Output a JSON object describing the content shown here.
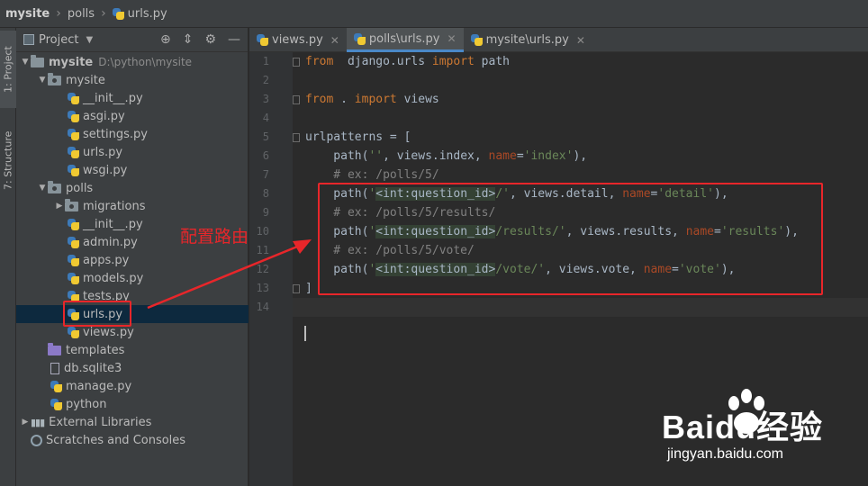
{
  "breadcrumb": {
    "root": "mysite",
    "folder": "polls",
    "file": "urls.py"
  },
  "toolstrip": {
    "project_tab": "1: Project",
    "structure_tab": "7: Structure"
  },
  "project_panel": {
    "title": "Project",
    "tree": [
      {
        "label": "mysite",
        "sub": "D:\\python\\mysite",
        "kind": "folder",
        "arrow": "▼",
        "depth": 0,
        "bold": true
      },
      {
        "label": "mysite",
        "kind": "pkg",
        "arrow": "▼",
        "depth": 1
      },
      {
        "label": "__init__.py",
        "kind": "py",
        "depth": 2
      },
      {
        "label": "asgi.py",
        "kind": "py",
        "depth": 2
      },
      {
        "label": "settings.py",
        "kind": "py",
        "depth": 2
      },
      {
        "label": "urls.py",
        "kind": "py",
        "depth": 2
      },
      {
        "label": "wsgi.py",
        "kind": "py",
        "depth": 2
      },
      {
        "label": "polls",
        "kind": "pkg",
        "arrow": "▼",
        "depth": 1
      },
      {
        "label": "migrations",
        "kind": "pkg",
        "arrow": "▶",
        "depth": 2
      },
      {
        "label": "__init__.py",
        "kind": "py",
        "depth": 2
      },
      {
        "label": "admin.py",
        "kind": "py",
        "depth": 2
      },
      {
        "label": "apps.py",
        "kind": "py",
        "depth": 2
      },
      {
        "label": "models.py",
        "kind": "py",
        "depth": 2
      },
      {
        "label": "tests.py",
        "kind": "py",
        "depth": 2
      },
      {
        "label": "urls.py",
        "kind": "py",
        "depth": 2,
        "selected": true
      },
      {
        "label": "views.py",
        "kind": "py",
        "depth": 2
      },
      {
        "label": "templates",
        "kind": "tpl",
        "depth": 1
      },
      {
        "label": "db.sqlite3",
        "kind": "db",
        "depth": 1
      },
      {
        "label": "manage.py",
        "kind": "py",
        "depth": 1
      },
      {
        "label": "python",
        "kind": "py",
        "depth": 1
      },
      {
        "label": "External Libraries",
        "kind": "lib",
        "arrow": "▶",
        "depth": 0
      },
      {
        "label": "Scratches and Consoles",
        "kind": "scratch",
        "depth": 0
      }
    ]
  },
  "editor": {
    "tabs": [
      {
        "label": "views.py",
        "active": false
      },
      {
        "label": "polls\\urls.py",
        "active": true
      },
      {
        "label": "mysite\\urls.py",
        "active": false
      }
    ],
    "line_numbers": [
      "1",
      "2",
      "3",
      "4",
      "5",
      "6",
      "7",
      "8",
      "9",
      "10",
      "11",
      "12",
      "13",
      "14"
    ],
    "lines": [
      [
        [
          "kw",
          "from"
        ],
        [
          "",
          "  django.urls "
        ],
        [
          "kw",
          "import"
        ],
        [
          "",
          " path"
        ]
      ],
      [],
      [
        [
          "kw",
          "from"
        ],
        [
          "",
          " . "
        ],
        [
          "kw",
          "import"
        ],
        [
          "",
          " views"
        ]
      ],
      [],
      [
        [
          "",
          "urlpatterns = ["
        ]
      ],
      [
        [
          "",
          "    path("
        ],
        [
          "str",
          "''"
        ],
        [
          "",
          ", views.index, "
        ],
        [
          "nm",
          "name"
        ],
        [
          "",
          "="
        ],
        [
          "str",
          "'index'"
        ],
        [
          "",
          "),"
        ]
      ],
      [
        [
          "cm",
          "    # ex: /polls/5/"
        ]
      ],
      [
        [
          "",
          "    path("
        ],
        [
          "str",
          "'"
        ],
        [
          "rt",
          "<int:question_id>"
        ],
        [
          "str",
          "/'"
        ],
        [
          "",
          ", views.detail, "
        ],
        [
          "nm",
          "name"
        ],
        [
          "",
          "="
        ],
        [
          "str",
          "'detail'"
        ],
        [
          "",
          "),"
        ]
      ],
      [
        [
          "cm",
          "    # ex: /polls/5/results/"
        ]
      ],
      [
        [
          "",
          "    path("
        ],
        [
          "str",
          "'"
        ],
        [
          "rt",
          "<int:question_id>"
        ],
        [
          "str",
          "/results/'"
        ],
        [
          "",
          ", views.results, "
        ],
        [
          "nm",
          "name"
        ],
        [
          "",
          "="
        ],
        [
          "str",
          "'results'"
        ],
        [
          "",
          "),"
        ]
      ],
      [
        [
          "cm",
          "    # ex: /polls/5/vote/"
        ]
      ],
      [
        [
          "",
          "    path("
        ],
        [
          "str",
          "'"
        ],
        [
          "rt",
          "<int:question_id>"
        ],
        [
          "str",
          "/vote/'"
        ],
        [
          "",
          ", views.vote, "
        ],
        [
          "nm",
          "name"
        ],
        [
          "",
          "="
        ],
        [
          "str",
          "'vote'"
        ],
        [
          "",
          "),"
        ]
      ],
      [
        [
          "",
          "]"
        ]
      ],
      []
    ]
  },
  "annotation": {
    "label": "配置路由",
    "color": "#e8262a"
  },
  "watermark": {
    "brand": "Baidu经验",
    "domain": "jingyan.baidu.com"
  }
}
